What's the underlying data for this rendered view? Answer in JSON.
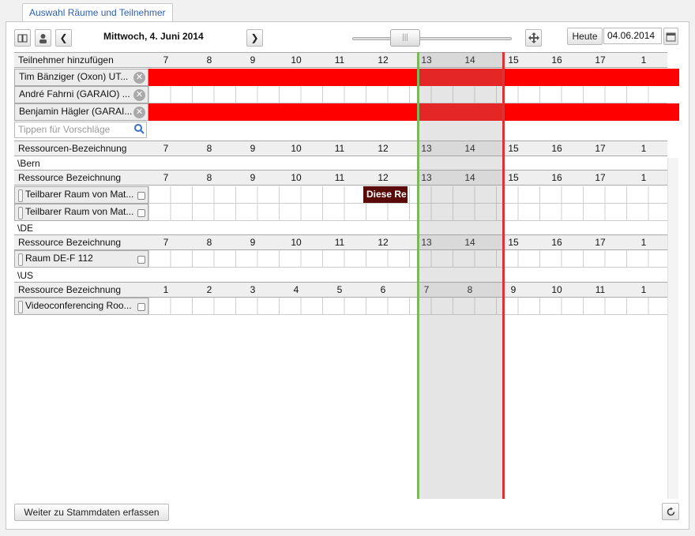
{
  "tab_label": "Auswahl Räume und Teilnehmer",
  "toolbar": {
    "date_title": "Mittwoch, 4. Juni 2014",
    "today_label": "Heute",
    "date_value": "04.06.2014",
    "slider_thumb": "|||"
  },
  "participants": {
    "header": "Teilnehmer hinzufügen",
    "hours": [
      "7",
      "8",
      "9",
      "10",
      "11",
      "12",
      "13",
      "14",
      "15",
      "16",
      "17",
      "1"
    ],
    "rows": [
      {
        "name": "Tim Bänziger (Oxon) UT...",
        "busy": true
      },
      {
        "name": "André Fahrni (GARAIO) ...",
        "busy": false
      },
      {
        "name": "Benjamin Hägler (GARAI...",
        "busy": true
      }
    ],
    "search_placeholder": "Tippen für Vorschläge"
  },
  "resources": {
    "header": "Ressourcen-Bezeichnung",
    "hours": [
      "7",
      "8",
      "9",
      "10",
      "11",
      "12",
      "13",
      "14",
      "15",
      "16",
      "17",
      "1"
    ],
    "groups": [
      {
        "name": "\\Bern",
        "header": "Ressource Bezeichnung",
        "hours": [
          "7",
          "8",
          "9",
          "10",
          "11",
          "12",
          "13",
          "14",
          "15",
          "16",
          "17",
          "1"
        ],
        "rows": [
          "Teilbarer Raum von Mat...",
          "Teilbarer Raum von Mat..."
        ]
      },
      {
        "name": "\\DE",
        "header": "Ressource Bezeichnung",
        "hours": [
          "7",
          "8",
          "9",
          "10",
          "11",
          "12",
          "13",
          "14",
          "15",
          "16",
          "17",
          "1"
        ],
        "rows": [
          "Raum DE-F 112"
        ]
      },
      {
        "name": "\\US",
        "header": "Ressource Bezeichnung",
        "hours": [
          "1",
          "2",
          "3",
          "4",
          "5",
          "6",
          "7",
          "8",
          "9",
          "10",
          "11",
          "1"
        ],
        "rows": [
          "Videoconferencing Roo..."
        ]
      }
    ],
    "event_label": "Diese Re"
  },
  "footer": {
    "next_label": "Weiter zu Stammdaten erfassen"
  },
  "colors": {
    "busy": "#ff0000",
    "selection_start": "#7ab85a",
    "selection_end": "#dd3333",
    "event": "#5b0a0a"
  }
}
